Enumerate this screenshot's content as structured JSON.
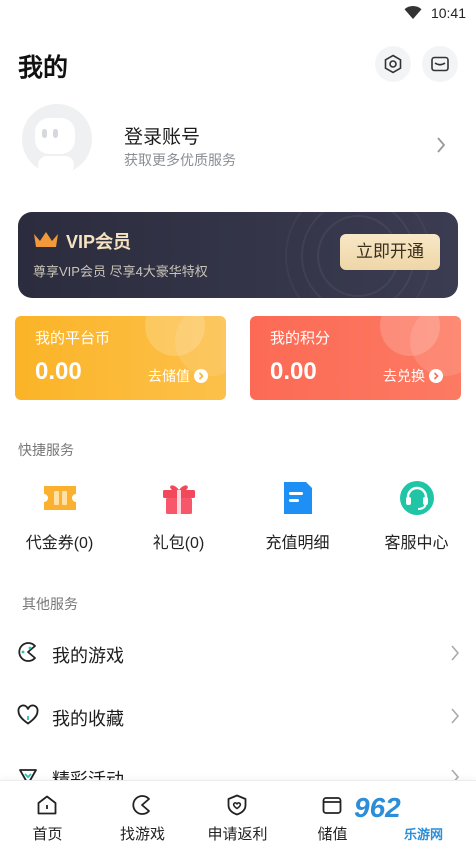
{
  "status_bar": {
    "time": "10:41"
  },
  "header": {
    "title": "我的",
    "settings_icon": "settings-hex-icon",
    "message_icon": "mail-icon"
  },
  "profile": {
    "title": "登录账号",
    "subtitle": "获取更多优质服务"
  },
  "vip": {
    "title": "VIP会员",
    "subtitle": "尊享VIP会员 尽享4大豪华特权",
    "button": "立即开通",
    "accent": "#f6e3c0"
  },
  "wallet": {
    "coins": {
      "label": "我的平台币",
      "value": "0.00",
      "action": "去储值",
      "color": "#fbb427"
    },
    "points": {
      "label": "我的积分",
      "value": "0.00",
      "action": "去兑换",
      "color": "#fc6a55"
    }
  },
  "quick_services": {
    "title": "快捷服务",
    "items": [
      {
        "label": "代金券(0)",
        "icon": "voucher-icon"
      },
      {
        "label": "礼包(0)",
        "icon": "gift-icon"
      },
      {
        "label": "充值明细",
        "icon": "recharge-detail-icon"
      },
      {
        "label": "客服中心",
        "icon": "customer-service-icon"
      }
    ]
  },
  "other_services": {
    "title": "其他服务",
    "items": [
      {
        "label": "我的游戏",
        "icon": "game-icon"
      },
      {
        "label": "我的收藏",
        "icon": "heart-icon"
      },
      {
        "label": "精彩活动",
        "icon": "activity-icon"
      }
    ]
  },
  "tabbar": {
    "items": [
      {
        "label": "首页",
        "icon": "home-icon"
      },
      {
        "label": "找游戏",
        "icon": "find-game-icon"
      },
      {
        "label": "申请返利",
        "icon": "rebate-icon"
      },
      {
        "label": "储值",
        "icon": "wallet-icon"
      }
    ]
  },
  "watermark": {
    "main": "962",
    "sub": "乐游网"
  }
}
